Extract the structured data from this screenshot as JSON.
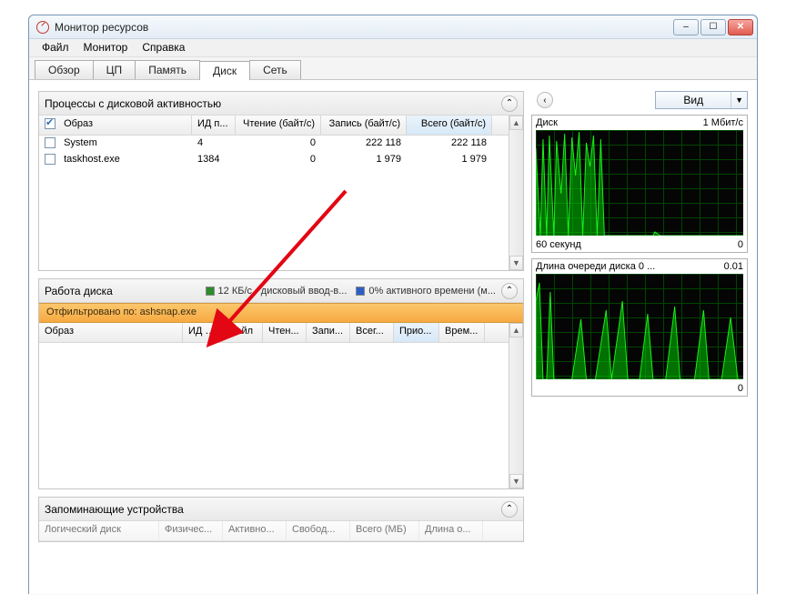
{
  "window": {
    "title": "Монитор ресурсов"
  },
  "menu": {
    "file": "Файл",
    "monitor": "Монитор",
    "help": "Справка"
  },
  "tabs": {
    "overview": "Обзор",
    "cpu": "ЦП",
    "memory": "Память",
    "disk": "Диск",
    "network": "Сеть"
  },
  "processes": {
    "title": "Процессы с дисковой активностью",
    "columns": {
      "image": "Образ",
      "pid": "ИД п...",
      "read": "Чтение (байт/с)",
      "write": "Запись (байт/с)",
      "total": "Всего (байт/с)"
    },
    "rows": [
      {
        "image": "System",
        "pid": "4",
        "read": "0",
        "write": "222 118",
        "total": "222 118"
      },
      {
        "image": "taskhost.exe",
        "pid": "1384",
        "read": "0",
        "write": "1 979",
        "total": "1 979"
      }
    ]
  },
  "disk_activity": {
    "title": "Работа диска",
    "io_rate": "12 КБ/с - дисковый ввод-в...",
    "active_time": "0% активного времени (м...",
    "filtered_by_prefix": "Отфильтровано по: ",
    "filtered_by_value": "ashsnap.exe",
    "columns": {
      "image": "Образ",
      "pid": "ИД п...",
      "file": "Файл",
      "read": "Чтен...",
      "write": "Запи...",
      "total": "Всег...",
      "prio": "Прио...",
      "resp": "Врем..."
    }
  },
  "storage": {
    "title": "Запоминающие устройства",
    "columns": {
      "logical": "Логический диск",
      "physical": "Физичес...",
      "active": "Активно...",
      "free": "Свобод...",
      "total": "Всего (МБ)",
      "queue": "Длина о..."
    }
  },
  "right": {
    "view": "Вид",
    "graph1": {
      "title": "Диск",
      "scale": "1 Мбит/с",
      "x_left": "60 секунд",
      "x_right": "0"
    },
    "graph2": {
      "title": "Длина очереди диска 0 ...",
      "scale": "0.01",
      "x_right": "0"
    }
  }
}
